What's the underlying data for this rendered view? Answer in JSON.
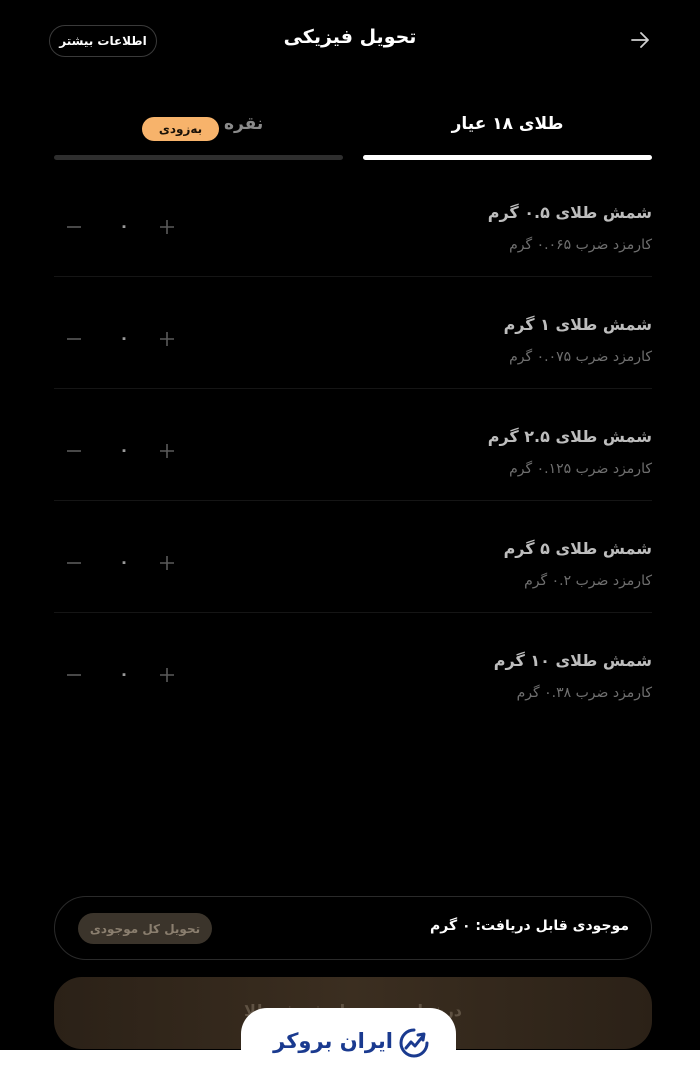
{
  "header": {
    "title": "تحویل فیزیکی",
    "info_button": "اطلاعات بیشتر",
    "back_icon": "arrow-right-icon"
  },
  "tabs": [
    {
      "label": "طلای ۱۸ عیار",
      "active": true
    },
    {
      "label": "نقره",
      "badge": "به‌زودی",
      "active": false
    }
  ],
  "products": [
    {
      "name": "شمش طلای ۰.۵ گرم",
      "fee": "کارمزد ضرب ۰.۰۶۵ گرم",
      "quantity": "۰"
    },
    {
      "name": "شمش طلای ۱ گرم",
      "fee": "کارمزد ضرب ۰.۰۷۵ گرم",
      "quantity": "۰"
    },
    {
      "name": "شمش طلای ۲.۵ گرم",
      "fee": "کارمزد ضرب ۰.۱۲۵ گرم",
      "quantity": "۰"
    },
    {
      "name": "شمش طلای ۵ گرم",
      "fee": "کارمزد ضرب ۰.۲ گرم",
      "quantity": "۰"
    },
    {
      "name": "شمش طلای ۱۰ گرم",
      "fee": "کارمزد ضرب ۰.۳۸ گرم",
      "quantity": "۰"
    }
  ],
  "balance": {
    "text": "موجودی قابل دریافت: ۰ گرم",
    "deliver_all_button": "تحویل کل موجودی"
  },
  "submit_button": "درخواست تحویل شمش طلا",
  "watermark": {
    "text": "ایران بروکر",
    "icon": "chart-trend-icon"
  },
  "colors": {
    "background": "#000000",
    "accent_badge": "#f7b36b",
    "watermark_blue": "#1a3a8f",
    "submit_gradient": "#3b2e20"
  }
}
